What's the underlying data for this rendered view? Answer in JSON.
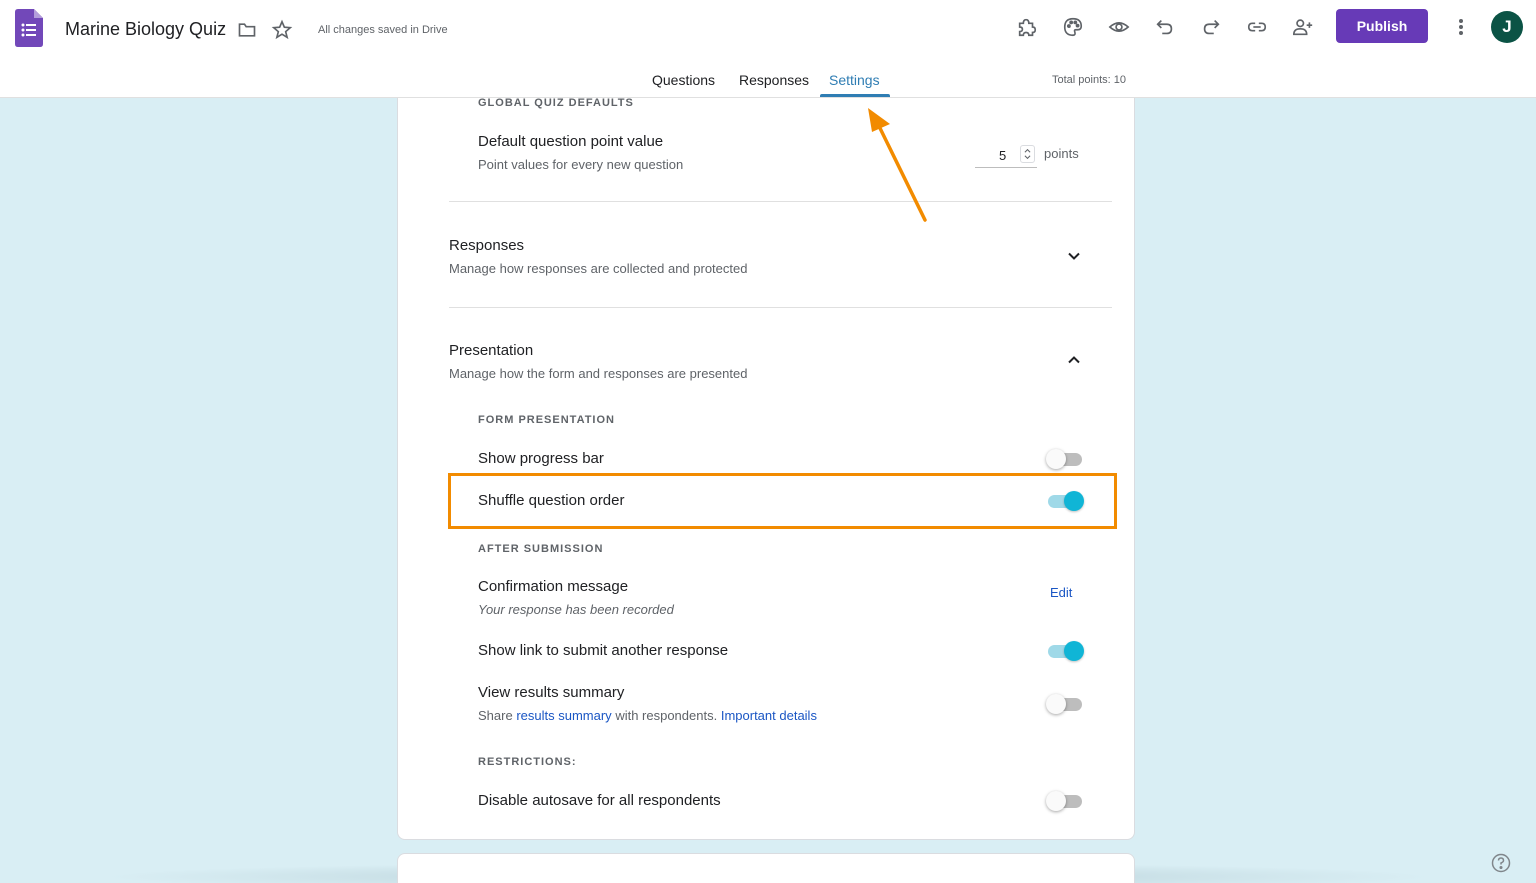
{
  "header": {
    "title": "Marine Biology Quiz",
    "save_status": "All changes saved in Drive",
    "publish_label": "Publish",
    "avatar_letter": "J",
    "tabs": [
      "Questions",
      "Responses",
      "Settings"
    ],
    "active_tab": "Settings",
    "total_points": "Total points: 10",
    "toolbar_icons": [
      "addons-icon",
      "palette-icon",
      "preview-icon",
      "undo-icon",
      "redo-icon",
      "link-icon",
      "add-collaborator-icon",
      "more-vert-icon"
    ]
  },
  "settings": {
    "global_defaults_label": "GLOBAL QUIZ DEFAULTS",
    "default_point": {
      "title": "Default question point value",
      "subtitle": "Point values for every new question",
      "value": "5",
      "unit": "points"
    },
    "responses": {
      "title": "Responses",
      "subtitle": "Manage how responses are collected and protected",
      "expanded": false
    },
    "presentation": {
      "title": "Presentation",
      "subtitle": "Manage how the form and responses are presented",
      "expanded": true,
      "form_presentation_label": "FORM PRESENTATION",
      "show_progress_bar": {
        "label": "Show progress bar",
        "on": false
      },
      "shuffle_question_order": {
        "label": "Shuffle question order",
        "on": true
      },
      "after_submission_label": "AFTER SUBMISSION",
      "confirmation": {
        "title": "Confirmation message",
        "message": "Your response has been recorded",
        "edit_label": "Edit"
      },
      "submit_another": {
        "label": "Show link to submit another response",
        "on": true
      },
      "results_summary": {
        "title": "View results summary",
        "sub_prefix": "Share",
        "sub_link": "results summary",
        "sub_middle": "with respondents.",
        "sub_link2": "Important details",
        "on": false
      },
      "restrictions_label": "RESTRICTIONS:",
      "disable_autosave": {
        "label": "Disable autosave for all respondents",
        "on": false
      }
    }
  },
  "colors": {
    "brand": "#673ab7",
    "accent": "#2f7db3",
    "toggle_on": "#10b5d6",
    "highlight": "#f28b00",
    "background": "#d9eef4"
  }
}
